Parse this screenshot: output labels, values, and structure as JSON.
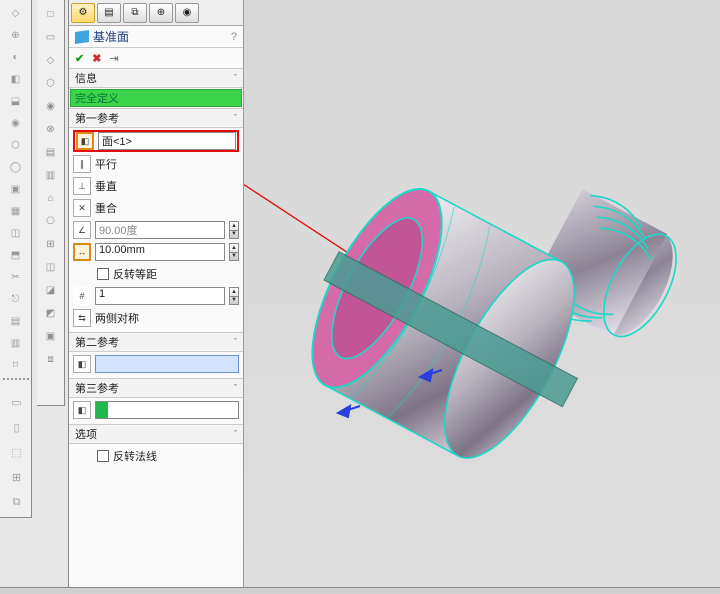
{
  "feature": {
    "title": "基准面",
    "help": "?"
  },
  "actions": {
    "ok": "✔",
    "cancel": "✖",
    "pin": "⇥"
  },
  "sections": {
    "info": "信息",
    "status": "完全定义",
    "ref1": "第一参考",
    "ref2": "第二参考",
    "ref3": "第三参考",
    "options": "选项"
  },
  "ref1": {
    "selection": "面<1>",
    "opt_parallel": "平行",
    "opt_perp": "垂直",
    "opt_coincident": "重合",
    "angle": "90.00度",
    "distance": "10.00mm",
    "reverse_label": "反转等距",
    "instances": "1",
    "midplane": "两侧对称"
  },
  "options": {
    "reverse_normal": "反转法线"
  },
  "colors": {
    "accent_wire": "#1bd9c8",
    "highlight_red": "#e40c0c",
    "face_pink": "#d46aa8"
  }
}
